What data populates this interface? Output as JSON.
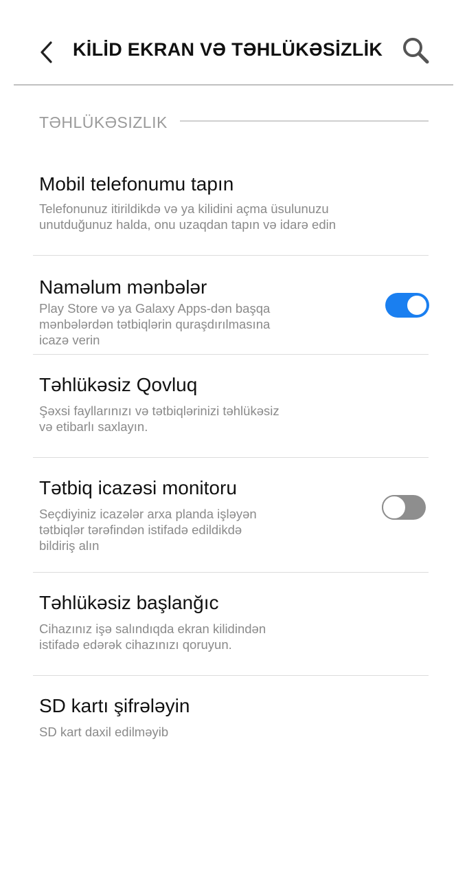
{
  "header": {
    "title": "KİLİD EKRAN VƏ TƏHLÜKƏSİZLİK"
  },
  "section": {
    "title": "TƏHLÜKƏSIZLIK"
  },
  "items": [
    {
      "title": "Mobil telefonumu tapın",
      "desc_line1": "Telefonunuz itirildikdə və ya kilidini açma üsulunuzu",
      "desc_line2": "unutduğunuz halda, onu uzaqdan tapın və idarə edin"
    },
    {
      "title": "Naməlum mənbələr",
      "desc_line1": "Play Store və ya Galaxy Apps-dən başqa",
      "desc_line2": "mənbələrdən tətbiqlərin quraşdırılmasına",
      "desc_line3": "icazə verin",
      "toggle": "on"
    },
    {
      "title": "Təhlükəsiz Qovluq",
      "desc_line1": "Şəxsi fayllarınızı və tətbiqlərinizi təhlükəsiz",
      "desc_line2": "və etibarlı saxlayın."
    },
    {
      "title": "Tətbiq icazəsi monitoru",
      "desc_line1": "Seçdiyiniz icazələr arxa planda işləyən",
      "desc_line2": "tətbiqlər tərəfindən istifadə edildikdə",
      "desc_line3": "bildiriş alın",
      "toggle": "off"
    },
    {
      "title": "Təhlükəsiz başlanğıc",
      "desc_line1": "Cihazınız işə salındıqda ekran kilidindən",
      "desc_line2": "istifadə edərək cihazınızı qoruyun."
    },
    {
      "title": "SD kartı şifrələyin",
      "desc_line1": "SD kart daxil edilməyib"
    }
  ],
  "colors": {
    "accent": "#1a7ff0",
    "toggle_off": "#8e8e8e",
    "secondary_text": "#8a8a8a"
  },
  "icons": {
    "back": "chevron-left-icon",
    "search": "search-icon"
  }
}
